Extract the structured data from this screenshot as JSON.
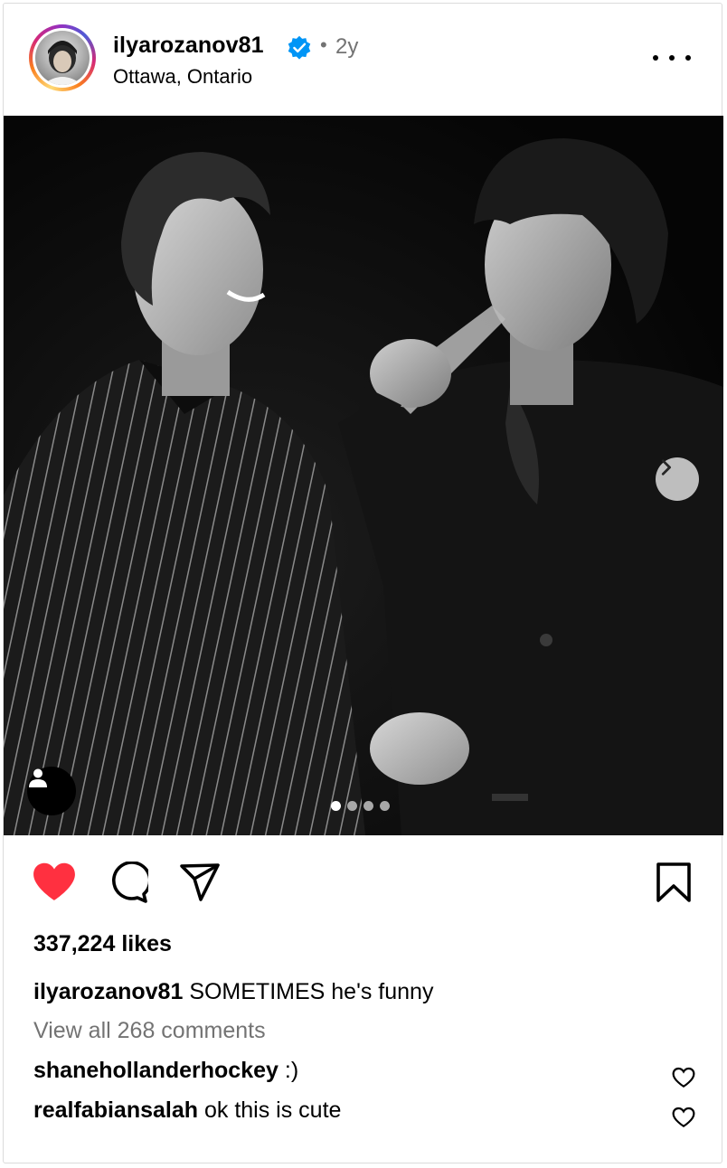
{
  "post": {
    "username": "ilyarozanov81",
    "time_separator": "•",
    "time": "2y",
    "location": "Ottawa, Ontario",
    "verified": true
  },
  "carousel": {
    "total": 4,
    "active_index": 0
  },
  "icons": {
    "like": "heart-filled-icon",
    "comment": "comment-icon",
    "share": "send-icon",
    "save": "bookmark-icon",
    "next": "chevron-right-icon",
    "tags": "user-icon",
    "more": "more-horizontal-icon"
  },
  "colors": {
    "like_red": "#ff3040",
    "verified_blue": "#0095f6",
    "muted": "#737373"
  },
  "stats": {
    "likes_text": "337,224 likes"
  },
  "caption": {
    "username": "ilyarozanov81",
    "text": "SOMETIMES he's funny"
  },
  "view_comments": "View all 268 comments",
  "comments": [
    {
      "username": "shanehollanderhockey",
      "text": ":)"
    },
    {
      "username": "realfabiansalah",
      "text": "ok this is cute"
    }
  ]
}
